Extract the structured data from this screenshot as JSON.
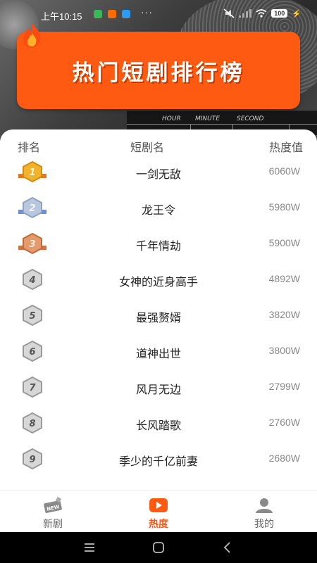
{
  "status": {
    "time": "上午10:15",
    "more": "···",
    "battery": "100",
    "app_icon_colors": [
      "#3bb75a",
      "#ff6a00",
      "#2e9bf0"
    ]
  },
  "header": {
    "title": "热门短剧排行榜",
    "clapper_labels": [
      "HOUR",
      "MINUTE",
      "SECOND"
    ],
    "accent": "#ff5a12"
  },
  "table": {
    "headers": {
      "rank": "排名",
      "name": "短剧名",
      "heat": "热度值"
    },
    "rows": [
      {
        "rank": "1",
        "name": "一剑无敌",
        "heat": "6060W",
        "badge": "gold"
      },
      {
        "rank": "2",
        "name": "龙王令",
        "heat": "5980W",
        "badge": "silver"
      },
      {
        "rank": "3",
        "name": "千年情劫",
        "heat": "5900W",
        "badge": "bronze"
      },
      {
        "rank": "4",
        "name": "女神的近身高手",
        "heat": "4892W",
        "badge": "plain"
      },
      {
        "rank": "5",
        "name": "最强赘婿",
        "heat": "3820W",
        "badge": "plain"
      },
      {
        "rank": "6",
        "name": "道神出世",
        "heat": "3800W",
        "badge": "plain"
      },
      {
        "rank": "7",
        "name": "风月无边",
        "heat": "2799W",
        "badge": "plain"
      },
      {
        "rank": "8",
        "name": "长风踏歌",
        "heat": "2760W",
        "badge": "plain"
      },
      {
        "rank": "9",
        "name": "季少的千亿前妻",
        "heat": "2680W",
        "badge": "plain"
      }
    ]
  },
  "tabs": [
    {
      "label": "新剧",
      "icon": "new-icon",
      "active": false
    },
    {
      "label": "热度",
      "icon": "play-icon",
      "active": true
    },
    {
      "label": "我的",
      "icon": "user-icon",
      "active": false
    }
  ],
  "nav": {
    "icons": [
      "menu-icon",
      "home-icon",
      "back-icon"
    ]
  }
}
